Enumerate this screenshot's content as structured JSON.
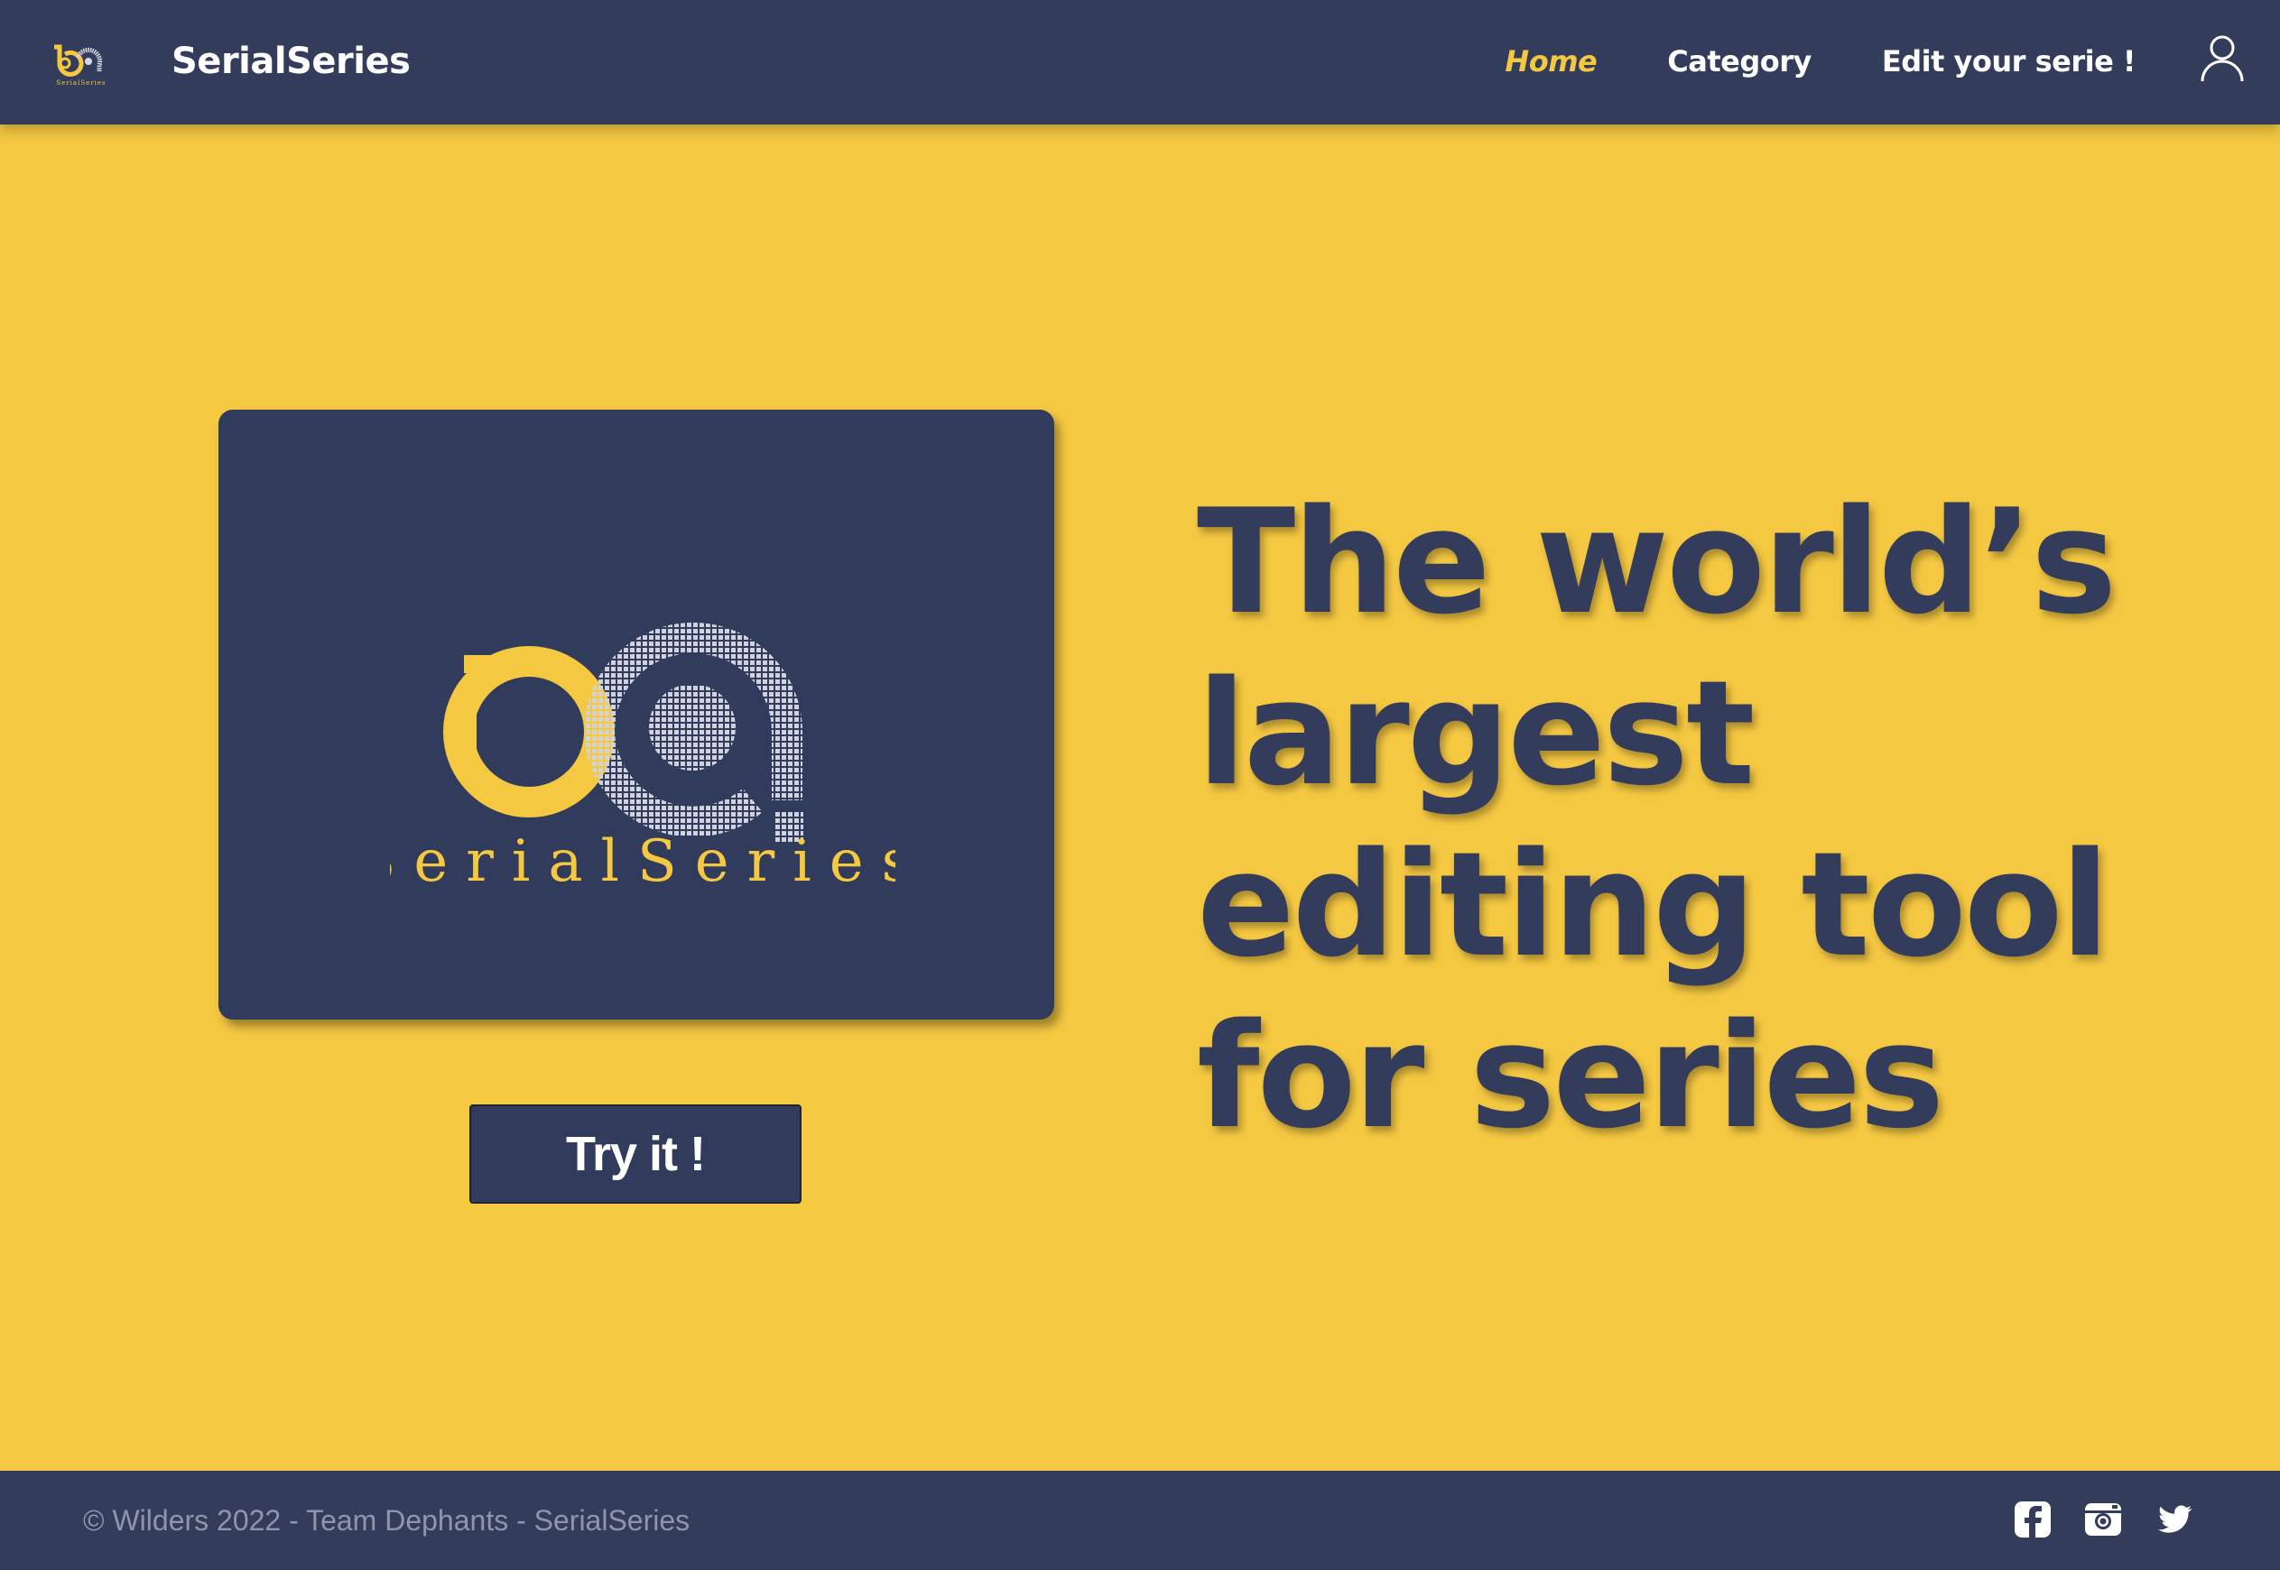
{
  "colors": {
    "navy": "#343c5c",
    "yellow": "#f5c842",
    "white": "#ffffff"
  },
  "header": {
    "brand": "SerialSeries",
    "nav": [
      {
        "label": "Home",
        "active": true
      },
      {
        "label": "Category",
        "active": false
      },
      {
        "label": "Edit your serie !",
        "active": false
      }
    ],
    "user_icon": "user-icon"
  },
  "hero": {
    "logo_wordmark": "SerialSeries",
    "cta_label": "Try it !",
    "headline_lines": [
      "The world’s",
      "largest",
      "editing tool",
      "for series"
    ]
  },
  "footer": {
    "copyright": "© Wilders 2022 - Team Dephants - SerialSeries",
    "social_icons": [
      "facebook-icon",
      "instagram-icon",
      "twitter-icon"
    ]
  }
}
